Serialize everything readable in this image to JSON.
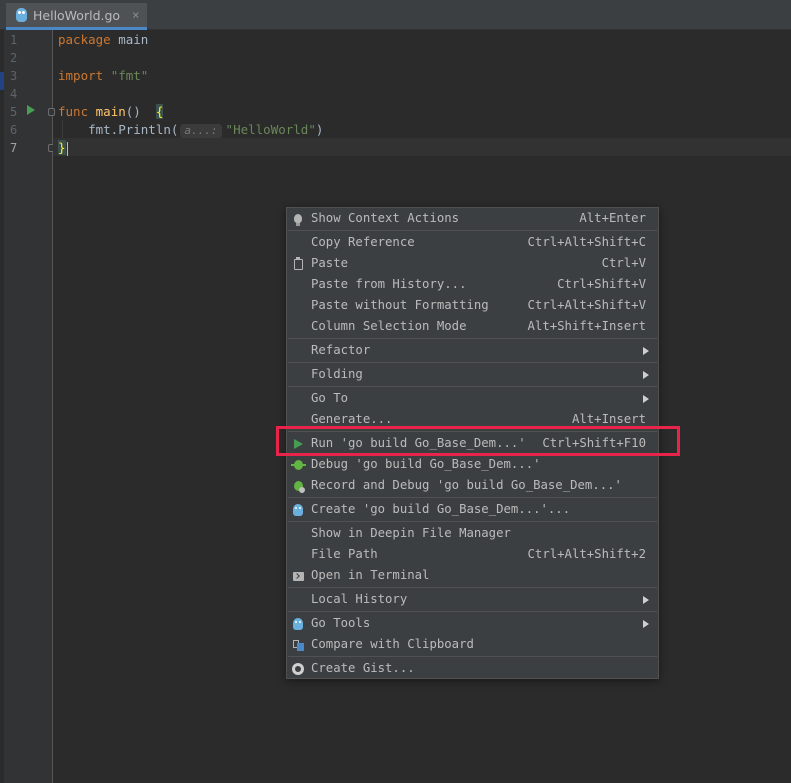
{
  "tab": {
    "name": "HelloWorld.go",
    "close": "×"
  },
  "editor": {
    "line_numbers": [
      "1",
      "2",
      "3",
      "4",
      "5",
      "6",
      "7"
    ],
    "code": {
      "l1_kw": "package",
      "l1_rest": " main",
      "l3_kw": "import",
      "l3_str": "\"fmt\"",
      "l5_kw": "func",
      "l5_fn": "main",
      "l5_paren": "() ",
      "l5_brace": "{",
      "l6_pre": "    fmt.Println(",
      "l6_hint": "a...:",
      "l6_str": "\"HelloWorld\"",
      "l6_post": ")",
      "l7_brace": "}"
    }
  },
  "menu": {
    "items": [
      {
        "label": "Show Context Actions",
        "shortcut": "Alt+Enter",
        "icon": "lightbulb-icon"
      },
      {
        "label": "Copy Reference",
        "shortcut": "Ctrl+Alt+Shift+C"
      },
      {
        "label": "Paste",
        "shortcut": "Ctrl+V",
        "icon": "clipboard-icon"
      },
      {
        "label": "Paste from History...",
        "shortcut": "Ctrl+Shift+V"
      },
      {
        "label": "Paste without Formatting",
        "shortcut": "Ctrl+Alt+Shift+V"
      },
      {
        "label": "Column Selection Mode",
        "shortcut": "Alt+Shift+Insert"
      },
      {
        "label": "Refactor",
        "shortcut": "",
        "submenu": true
      },
      {
        "label": "Folding",
        "shortcut": "",
        "submenu": true
      },
      {
        "label": "Go To",
        "shortcut": "",
        "submenu": true
      },
      {
        "label": "Generate...",
        "shortcut": "Alt+Insert"
      },
      {
        "label": "Run 'go build Go_Base_Dem...'",
        "shortcut": "Ctrl+Shift+F10",
        "icon": "run-icon"
      },
      {
        "label": "Debug 'go build Go_Base_Dem...'",
        "shortcut": "",
        "icon": "debug-icon"
      },
      {
        "label": "Record and Debug 'go build Go_Base_Dem...'",
        "shortcut": "",
        "icon": "record-debug-icon"
      },
      {
        "label": "Create 'go build Go_Base_Dem...'...",
        "shortcut": "",
        "icon": "go-gopher-icon"
      },
      {
        "label": "Show in Deepin File Manager",
        "shortcut": ""
      },
      {
        "label": "File Path",
        "shortcut": "Ctrl+Alt+Shift+2"
      },
      {
        "label": "Open in Terminal",
        "shortcut": "",
        "icon": "terminal-icon"
      },
      {
        "label": "Local History",
        "shortcut": "",
        "submenu": true
      },
      {
        "label": "Go Tools",
        "shortcut": "",
        "submenu": true,
        "icon": "go-gopher-icon"
      },
      {
        "label": "Compare with Clipboard",
        "shortcut": "",
        "icon": "compare-icon"
      },
      {
        "label": "Create Gist...",
        "shortcut": "",
        "icon": "github-icon"
      }
    ]
  },
  "colors": {
    "highlight_box": "#e8244b",
    "run_green": "#499c54"
  }
}
